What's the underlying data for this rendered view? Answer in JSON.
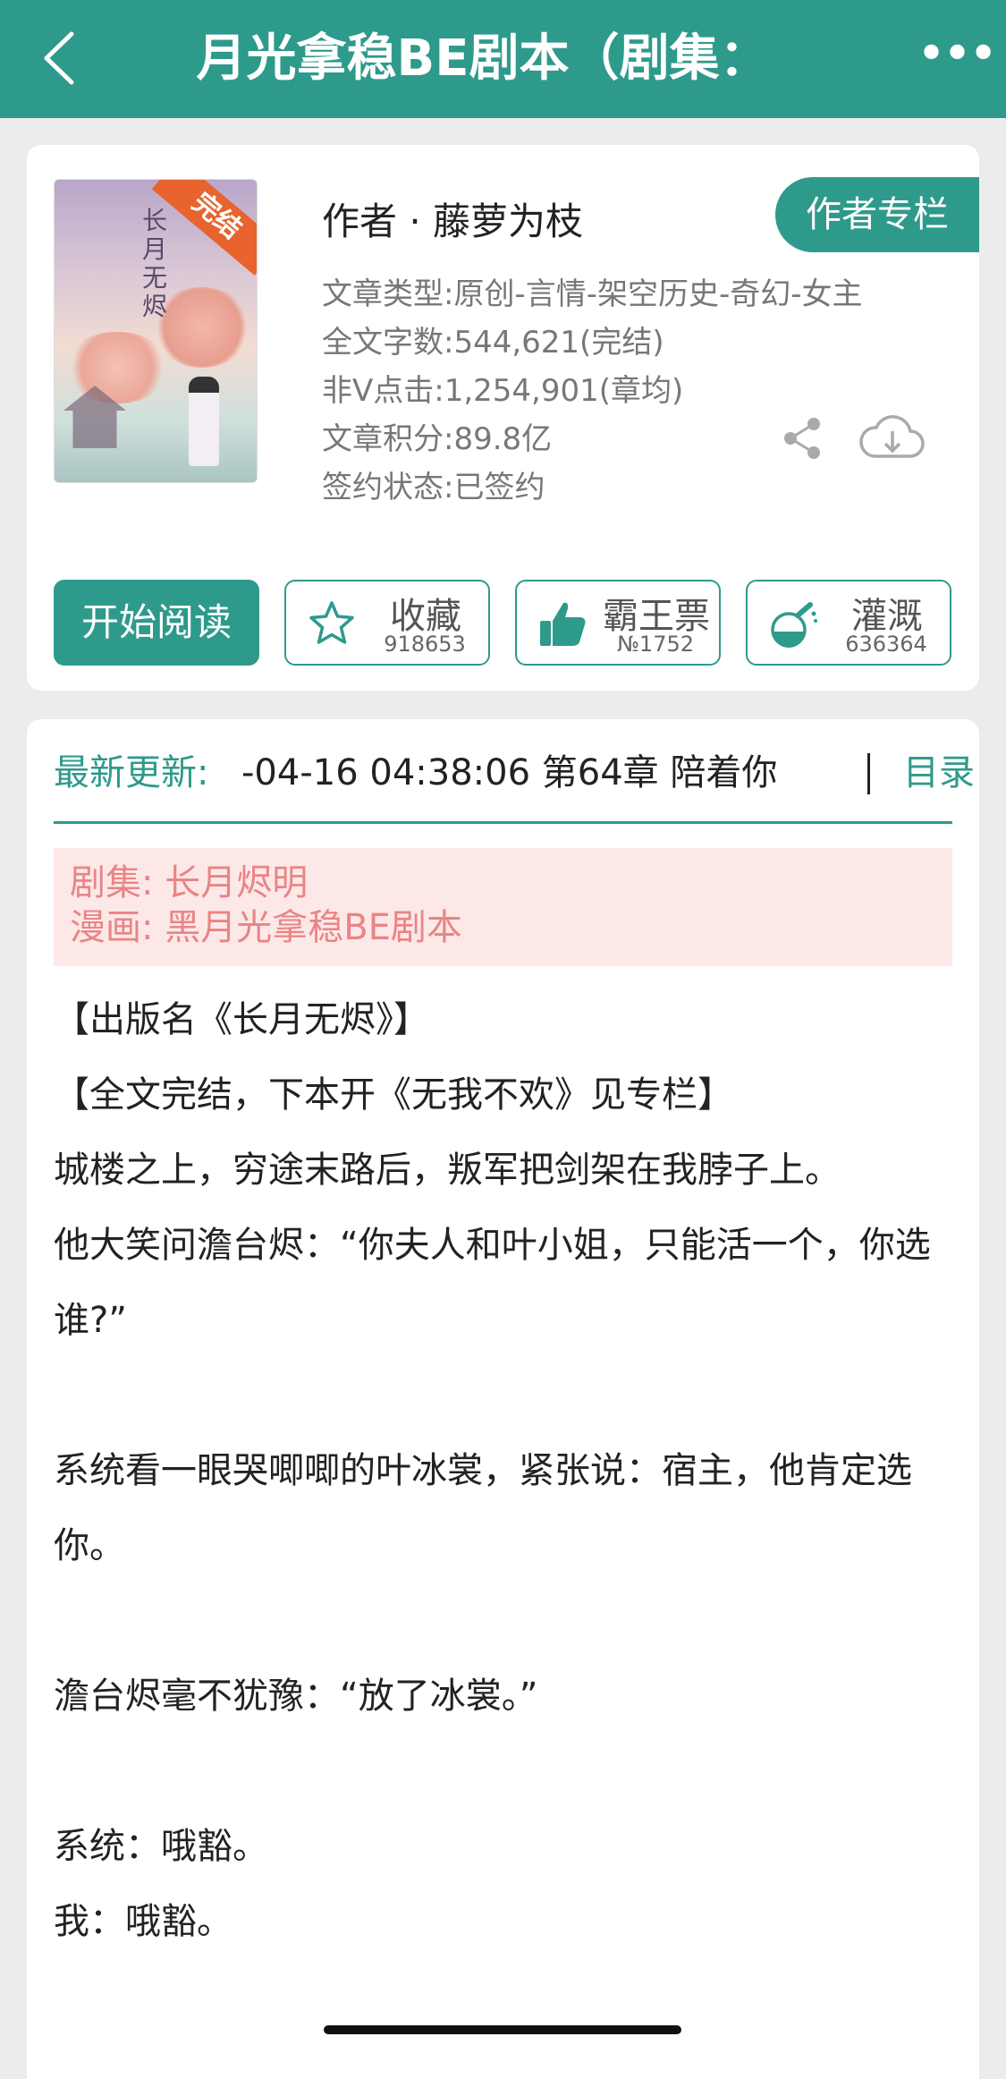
{
  "header": {
    "title": "月光拿稳BE剧本（剧集：",
    "back_icon": "chevron-left-icon",
    "more_label": "•••"
  },
  "book": {
    "cover_badge": "完结",
    "cover_title": "长月无烬",
    "author_line": "作者 · 藤萝为枝",
    "author_column_label": "作者专栏",
    "meta": {
      "type": "文章类型:原创-言情-架空历史-奇幻-女主",
      "word_count": "全文字数:544,621(完结)",
      "clicks": "非V点击:1,254,901(章均)",
      "score": "文章积分:89.8亿",
      "sign_status": "签约状态:已签约"
    },
    "share_icon": "share-icon",
    "download_icon": "cloud-download-icon"
  },
  "actions": {
    "read_label": "开始阅读",
    "collect": {
      "label": "收藏",
      "count": "918653",
      "icon": "star-icon"
    },
    "vote": {
      "label": "霸王票",
      "count": "№1752",
      "icon": "thumbs-up-icon"
    },
    "water": {
      "label": "灌溉",
      "count": "636364",
      "icon": "flask-icon"
    }
  },
  "update": {
    "label": "最新更新:",
    "text": "-04-16 04:38:06   第64章 陪着你",
    "toc_label": "目录"
  },
  "adaptations": {
    "drama": "剧集: 长月烬明",
    "comic": "漫画: 黑月光拿稳BE剧本"
  },
  "synopsis": {
    "line1": "【出版名《长月无烬》】",
    "line2": "【全文完结，下本开《无我不欢》见专栏】",
    "line3": "城楼之上，穷途末路后，叛军把剑架在我脖子上。",
    "line4": "他大笑问澹台烬：“你夫人和叶小姐，只能活一个，你选谁?”",
    "line5": "系统看一眼哭唧唧的叶冰裳，紧张说：宿主，他肯定选你。",
    "line6": "澹台烬毫不犹豫：“放了冰裳。”",
    "line7": "系统：哦豁。",
    "line8": "我：哦豁。"
  },
  "colors": {
    "accent": "#2e9a8b",
    "adapt_bg": "#fde8e8",
    "adapt_text": "#e98585",
    "badge": "#e8632e"
  }
}
